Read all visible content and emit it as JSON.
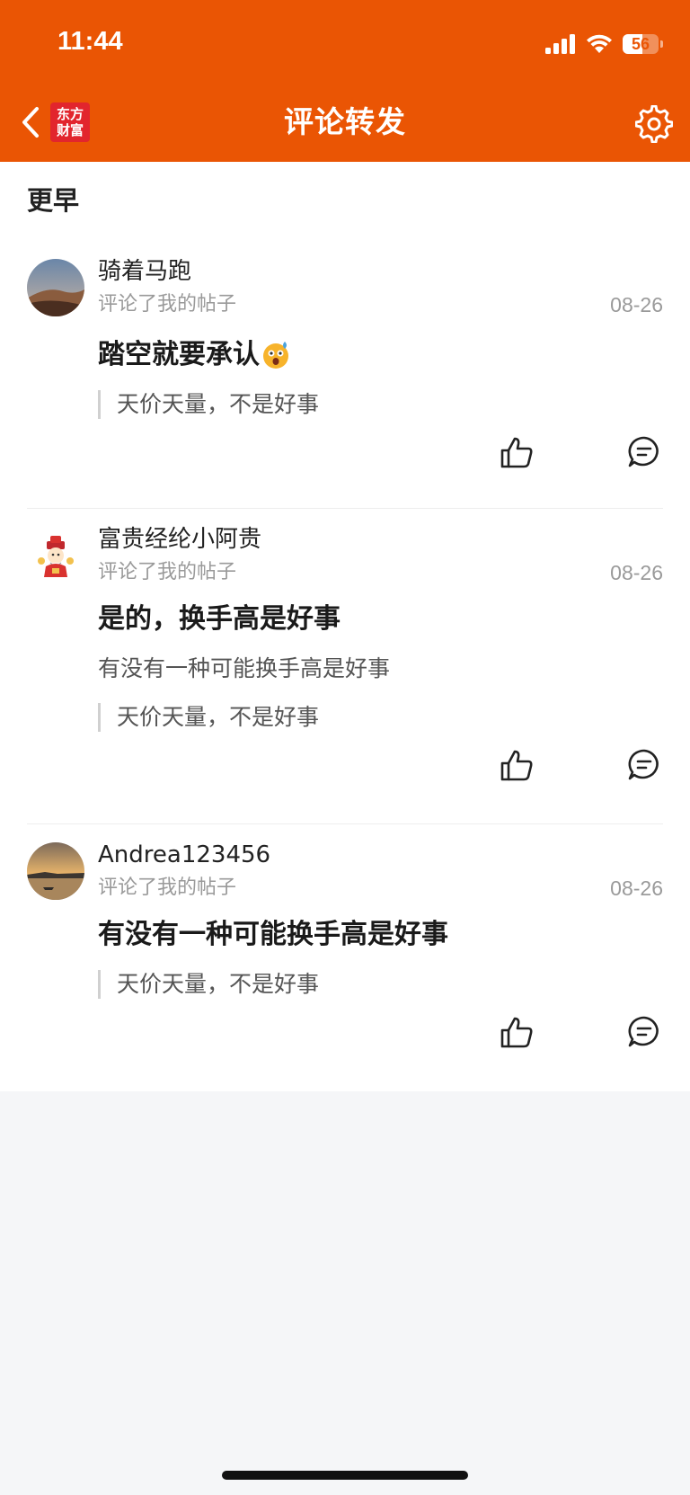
{
  "status_bar": {
    "time": "11:44",
    "battery": "56",
    "battery_level": 0.56,
    "signal_icon": "cellular-signal-icon",
    "wifi_icon": "wifi-icon"
  },
  "header": {
    "title": "评论转发",
    "logo_line1": "东方",
    "logo_line2": "财富",
    "back_icon": "chevron-left-icon",
    "settings_icon": "gear-icon",
    "background_color": "#ea5504"
  },
  "section": {
    "title": "更早"
  },
  "items": [
    {
      "username": "骑着马跑",
      "action": "评论了我的帖子",
      "date": "08-26",
      "comment": "踏空就要承认",
      "comment_emoji": "shocked-emoji",
      "reply": "",
      "quote": "天价天量，不是好事"
    },
    {
      "username": "富贵经纶小阿贵",
      "action": "评论了我的帖子",
      "date": "08-26",
      "comment": "是的，换手高是好事",
      "reply": "有没有一种可能换手高是好事",
      "quote": "天价天量，不是好事"
    },
    {
      "username": "Andrea123456",
      "action": "评论了我的帖子",
      "date": "08-26",
      "comment": "有没有一种可能换手高是好事",
      "reply": "",
      "quote": "天价天量，不是好事"
    }
  ]
}
